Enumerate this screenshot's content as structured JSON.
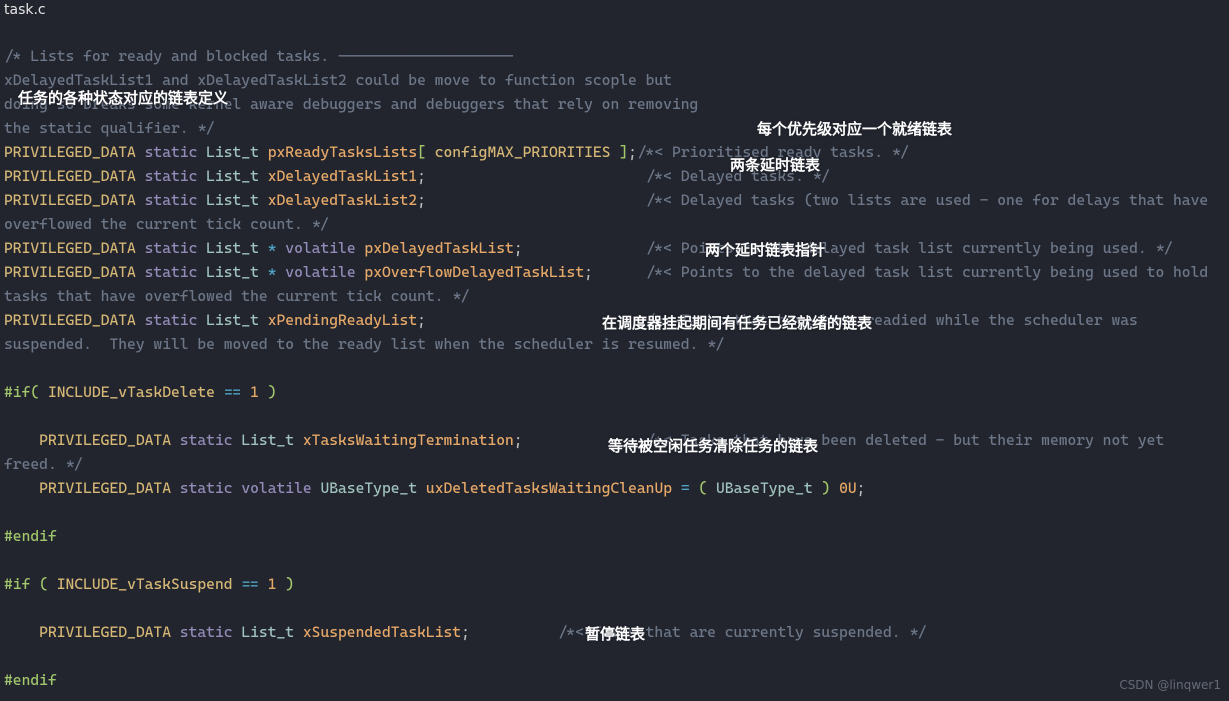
{
  "filename": "task.c",
  "code": {
    "l01": "/* Lists for ready and blocked tasks. --------------------",
    "l02": "xDelayedTaskList1 and xDelayedTaskList2 could be move to function scople but",
    "l03": "doing so breaks some kernel aware debuggers and debuggers that rely on removing",
    "l04": "the static qualifier. */",
    "l05_a": "PRIVILEGED_DATA",
    "l05_b": "static",
    "l05_c": "List_t",
    "l05_d": "pxReadyTasksLists",
    "l05_e": "[",
    "l05_f": "configMAX_PRIORITIES",
    "l05_g": "]",
    "l05_h": ";",
    "l05_i": "/*< Prioritised ready tasks. */",
    "l06_a": "PRIVILEGED_DATA",
    "l06_b": "static",
    "l06_c": "List_t",
    "l06_d": "xDelayedTaskList1",
    "l06_e": ";",
    "l06_f": "                         /*< Delayed tasks. */",
    "l07_a": "PRIVILEGED_DATA",
    "l07_b": "static",
    "l07_c": "List_t",
    "l07_d": "xDelayedTaskList2",
    "l07_e": ";",
    "l07_f": "                         /*< Delayed tasks (two lists are used - one for delays that have overflowed the current tick count. */",
    "l08_a": "PRIVILEGED_DATA",
    "l08_b": "static",
    "l08_c": "List_t",
    "l08_d": "*",
    "l08_e": "volatile",
    "l08_f": "pxDelayedTaskList",
    "l08_g": ";",
    "l08_h": "              /*< Points to the delayed task list currently being used. */",
    "l09_a": "PRIVILEGED_DATA",
    "l09_b": "static",
    "l09_c": "List_t",
    "l09_d": "*",
    "l09_e": "volatile",
    "l09_f": "pxOverflowDelayedTaskList",
    "l09_g": ";",
    "l09_h": "      /*< Points to the delayed task list currently being used to hold tasks that have overflowed the current tick count. */",
    "l10_a": "PRIVILEGED_DATA",
    "l10_b": "static",
    "l10_c": "List_t",
    "l10_d": "xPendingReadyList",
    "l10_e": ";",
    "l10_f": "                         /*< Tasks that have been readied while the scheduler was suspended.  They will be moved to the ready list when the scheduler is resumed. */",
    "l11_a": "#if",
    "l11_b": "(",
    "l11_c": "INCLUDE_vTaskDelete",
    "l11_d": "==",
    "l11_e": "1",
    "l11_f": ")",
    "l12_a": "    PRIVILEGED_DATA",
    "l12_b": "static",
    "l12_c": "List_t",
    "l12_d": "xTasksWaitingTermination",
    "l12_e": ";",
    "l12_f": "              /*< Tasks that have been deleted - but their memory not yet freed. */",
    "l13_a": "    PRIVILEGED_DATA",
    "l13_b": "static",
    "l13_c": "volatile",
    "l13_d": "UBaseType_t",
    "l13_e": "uxDeletedTasksWaitingCleanUp",
    "l13_f": "=",
    "l13_g": "(",
    "l13_h": "UBaseType_t",
    "l13_i": ")",
    "l13_j": "0U",
    "l13_k": ";",
    "l14": "#endif",
    "l15_a": "#if",
    "l15_b": "(",
    "l15_c": "INCLUDE_vTaskSuspend",
    "l15_d": "==",
    "l15_e": "1",
    "l15_f": ")",
    "l16_a": "    PRIVILEGED_DATA",
    "l16_b": "static",
    "l16_c": "List_t",
    "l16_d": "xSuspendedTaskList",
    "l16_e": ";",
    "l16_f": "          /*< Tasks that are currently suspended. */",
    "l17": "#endif"
  },
  "annotations": {
    "a1": "任务的各种状态对应的链表定义",
    "a2": "每个优先级对应一个就绪链表",
    "a3": "两条延时链表",
    "a4": "两个延时链表指针",
    "a5": "在调度器挂起期间有任务已经就绪的链表",
    "a6": "等待被空闲任务清除任务的链表",
    "a7": "暂停链表"
  },
  "watermark": "CSDN @linqwer1"
}
